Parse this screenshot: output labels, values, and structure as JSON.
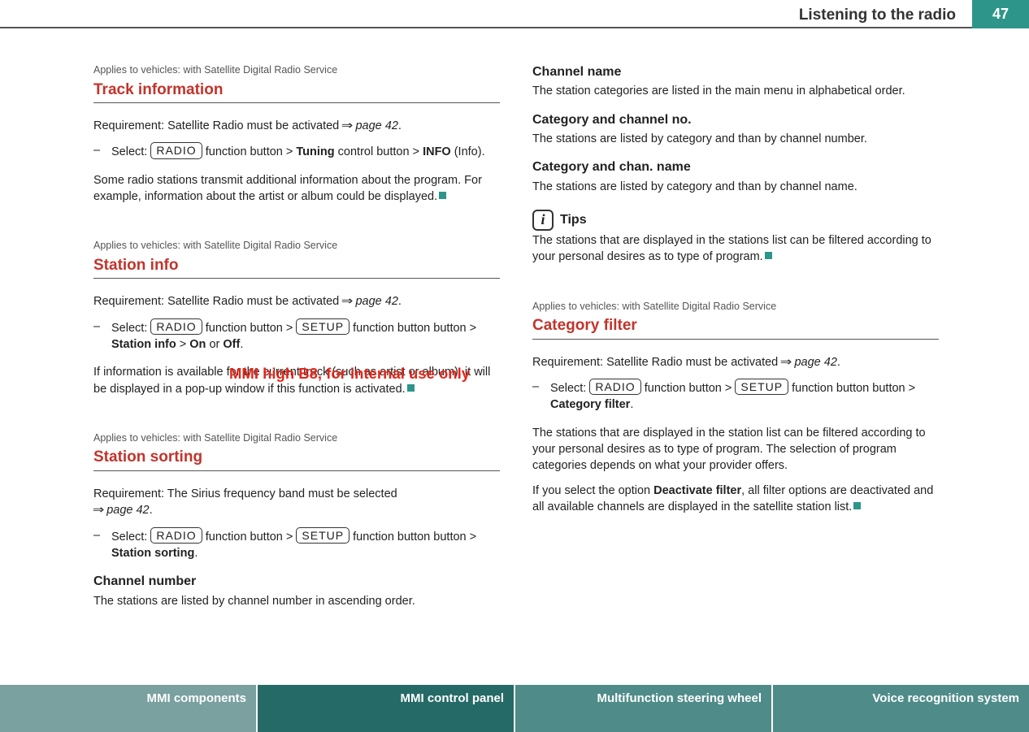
{
  "header": {
    "title": "Listening to the radio",
    "page_number": "47"
  },
  "watermark": "MMI high B8, for internal use only",
  "common": {
    "applies": "Applies to vehicles: with Satellite Digital Radio Service",
    "radio": "RADIO",
    "setup": "SETUP",
    "select": "Select: ",
    "fn_button": " function button > ",
    "fn_button_end": " function button",
    "button_gt": "button > ",
    "pageref": "page 42",
    "req_sat": "Requirement: Satellite Radio must be activated ",
    "period": "."
  },
  "s1": {
    "title": "Track information",
    "instr_b": "Tuning",
    "instr_c": " control button > ",
    "instr_d": "INFO",
    "instr_e": " (Info).",
    "para": "Some radio stations transmit additional information about the program. For example, information about the artist or album could be displayed."
  },
  "s2": {
    "title": "Station info",
    "instr_d": "Station info",
    "instr_e": " > ",
    "instr_f": "On",
    "instr_g": " or ",
    "instr_h": "Off",
    "para": "If information is available for the current track (such as artist or album), it will be displayed in a pop-up window if this function is activated."
  },
  "s3": {
    "title": "Station sorting",
    "req": "Requirement: The Sirius frequency band must be selected ",
    "instr_d": "Station sorting",
    "sub1_h": "Channel number",
    "sub1_p": "The stations are listed by channel number in ascending order.",
    "sub2_h": "Channel name",
    "sub2_p": "The station categories are listed in the main menu in alphabetical order.",
    "sub3_h": "Category and channel no.",
    "sub3_p": "The stations are listed by category and than by channel number.",
    "sub4_h": "Category and chan. name",
    "sub4_p": "The stations are listed by category and than by channel name.",
    "tips_label": "Tips",
    "tips_p": "The stations that are displayed in the stations list can be filtered according to your personal desires as to type of program."
  },
  "s4": {
    "title": "Category filter",
    "instr_d": "Category filter",
    "para1": "The stations that are displayed in the station list can be filtered according to your personal desires as to type of program. The selec­tion of program categories depends on what your provider offers.",
    "para2a": "If you select the option ",
    "para2b": "Deactivate filter",
    "para2c": ", all filter options are deacti­vated and all available channels are displayed in the satellite station list."
  },
  "footer": {
    "t1": "MMI components",
    "t2": "MMI control panel",
    "t3": "Multifunction steering wheel",
    "t4": "Voice recognition system"
  }
}
